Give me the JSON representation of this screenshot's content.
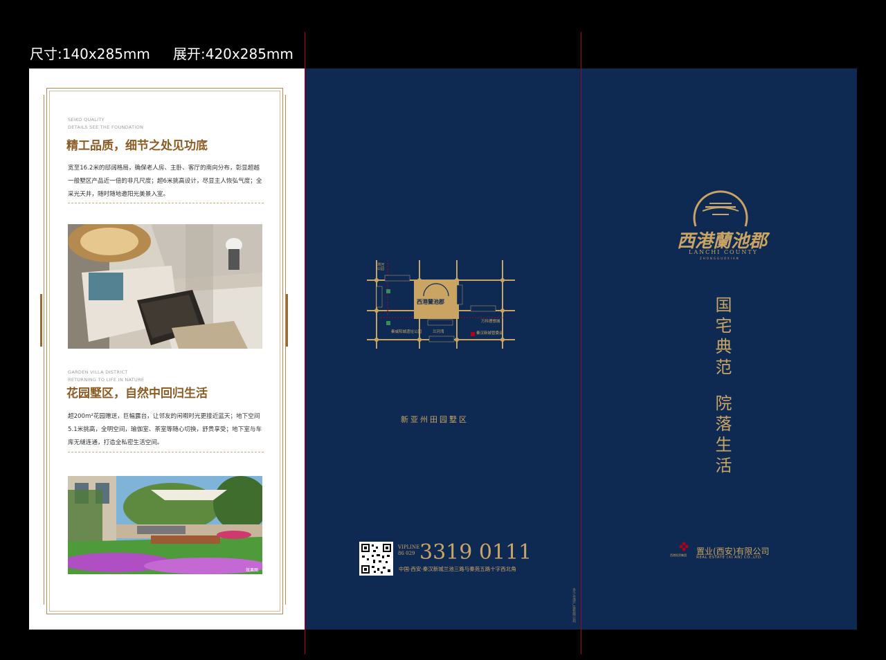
{
  "specs": {
    "size": "尺寸:140x285mm",
    "unfold": "展开:420x285mm"
  },
  "left_panel": {
    "section1": {
      "en_line1": "SEIKO QUALITY",
      "en_line2": "DETAILS SEE THE FOUNDATION",
      "heading": "精工品质，细节之处见功底",
      "body": "宽至16.2米的邸阔格局，确保老人房、主卧、客厅的南向分布，彰显超越一般墅区产品近一倍的非凡尺度；超6米挑高设计，尽显主人恢弘气度；全采光天井，随时随地邀阳光美景入室。"
    },
    "section2": {
      "en_line1": "GARDEN VILLA DISTRICT",
      "en_line2": "RETURNING TO LIFE IN NATURE",
      "heading": "花园墅区，自然中回归生活",
      "body": "超200m²花园赠送，巨幅露台，让邻友的闲暇时光更接近蓝天；地下空间5.1米挑高，全明空间，瑜伽室、茶室等随心切换，舒贵享受；地下室与车库无缝连通，打造全私密生活空间。"
    },
    "photo_caption": "效果图"
  },
  "middle_panel": {
    "map_center_label": "西港蘭池郡",
    "map_labels": [
      "渭河公园",
      "秦汉新城管委会",
      "秦咸阳城遗址公园",
      "兰池大道",
      "正阳大道",
      "万科理想城",
      "兰池三路",
      "泰苑五路",
      "兰河湾",
      "兰池大道",
      "亚欧大道",
      "秦汉大道"
    ],
    "caption": "新亚州田园墅区",
    "vipline_label": "VIPLINE",
    "area_code": "86 029",
    "phone": "3319 0111",
    "address": "中国·西安·秦汉新城兰池三路与秦苑五路十字西北角",
    "side_note": "多少合适广告有限公司"
  },
  "right_panel": {
    "logo_cn": "西港蘭池郡",
    "logo_en": "LANCHI COUNTY",
    "logo_en_sub": "ZHONGGUOXIAN",
    "slogan1": "国宅典范",
    "slogan2": "院落生活",
    "company_small": "西港投资集团",
    "company_cn": "置业(西安)有限公司",
    "company_en": "REAL ESTATE (XI AN) CO.,LTD."
  },
  "colors": {
    "navy": "#0f2a52",
    "gold": "#c9a463",
    "brown": "#8e5b23",
    "cutline": "#b0001a"
  }
}
